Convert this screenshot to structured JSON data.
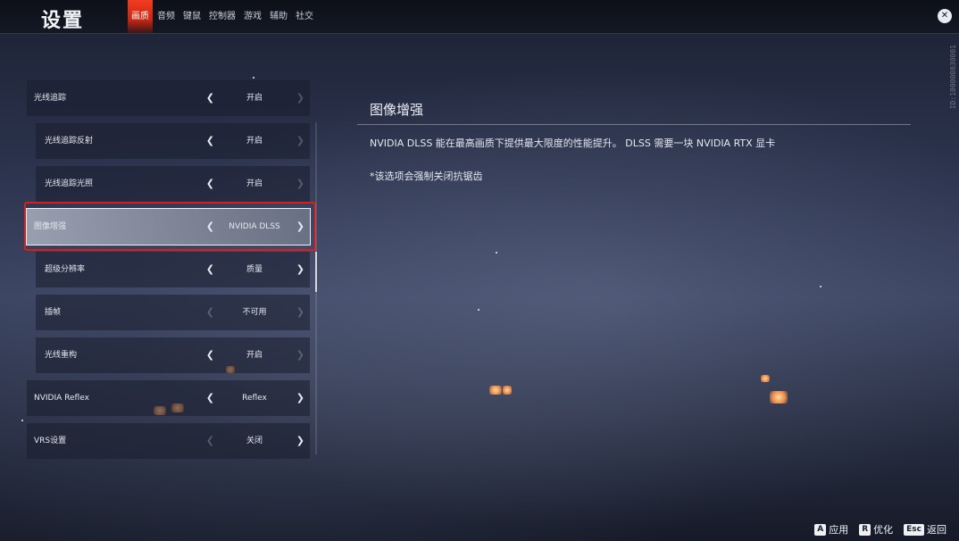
{
  "header": {
    "title": "设置",
    "tabs": [
      "画质",
      "音频",
      "键鼠",
      "控制器",
      "游戏",
      "辅助",
      "社交"
    ],
    "active_tab": "画质"
  },
  "side_id": "ID:100000030001",
  "settings": [
    {
      "label": "光线追踪",
      "value": "开启",
      "level": 0,
      "left_enabled": true,
      "right_enabled": false
    },
    {
      "label": "光线追踪反射",
      "value": "开启",
      "level": 1,
      "left_enabled": true,
      "right_enabled": false
    },
    {
      "label": "光线追踪光照",
      "value": "开启",
      "level": 1,
      "left_enabled": true,
      "right_enabled": false
    },
    {
      "label": "图像增强",
      "value": "NVIDIA DLSS",
      "level": 0,
      "left_enabled": true,
      "right_enabled": true,
      "selected": true
    },
    {
      "label": "超级分辨率",
      "value": "质量",
      "level": 1,
      "left_enabled": true,
      "right_enabled": true
    },
    {
      "label": "插帧",
      "value": "不可用",
      "level": 1,
      "left_enabled": false,
      "right_enabled": false
    },
    {
      "label": "光线重构",
      "value": "开启",
      "level": 1,
      "left_enabled": true,
      "right_enabled": false
    },
    {
      "label": "NVIDIA Reflex",
      "value": "Reflex",
      "level": 0,
      "left_enabled": true,
      "right_enabled": true
    },
    {
      "label": "VRS设置",
      "value": "关闭",
      "level": 0,
      "left_enabled": false,
      "right_enabled": true
    }
  ],
  "description": {
    "title": "图像增强",
    "text": "NVIDIA DLSS 能在最高画质下提供最大限度的性能提升。 DLSS 需要一块 NVIDIA RTX 显卡",
    "note": "*该选项会强制关闭抗锯齿"
  },
  "hints": [
    {
      "key": "A",
      "label": "应用"
    },
    {
      "key": "R",
      "label": "优化"
    },
    {
      "key": "Esc",
      "label": "返回"
    }
  ],
  "icons": {
    "close": "close-icon",
    "arrow_left": "chevron-left-icon",
    "arrow_right": "chevron-right-icon"
  },
  "colors": {
    "accent": "#e8321a",
    "highlight_box": "#e01b1b"
  }
}
